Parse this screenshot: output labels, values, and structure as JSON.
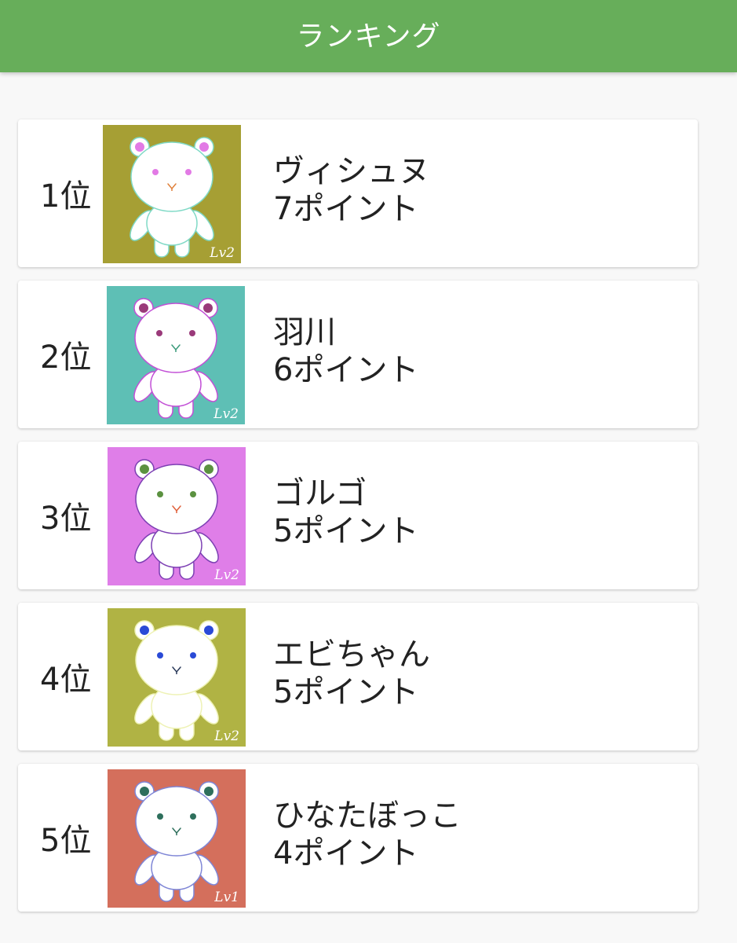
{
  "header": {
    "title": "ランキング"
  },
  "rankings": [
    {
      "rank": "1位",
      "name": "ヴィシュヌ",
      "points": "7ポイント",
      "level": "Lv2",
      "bg": "#a69f34",
      "outline": "#7fd9c6",
      "ear": "#e27ae5",
      "eye": "#e27ae5",
      "nose": "#e0803a"
    },
    {
      "rank": "2位",
      "name": "羽川",
      "points": "6ポイント",
      "level": "Lv2",
      "bg": "#5ebfb5",
      "outline": "#c24fd6",
      "ear": "#9a3a7a",
      "eye": "#9a3a7a",
      "nose": "#3a9a7a"
    },
    {
      "rank": "3位",
      "name": "ゴルゴ",
      "points": "5ポイント",
      "level": "Lv2",
      "bg": "#df7ee8",
      "outline": "#7c3fb3",
      "ear": "#5b9140",
      "eye": "#5b9140",
      "nose": "#e0603a"
    },
    {
      "rank": "4位",
      "name": "エビちゃん",
      "points": "5ポイント",
      "level": "Lv2",
      "bg": "#b0b344",
      "outline": "#eef2b5",
      "ear": "#2a4ad6",
      "eye": "#2a4ad6",
      "nose": "#2a3a5a"
    },
    {
      "rank": "5位",
      "name": "ひなたぼっこ",
      "points": "4ポイント",
      "level": "Lv1",
      "bg": "#d46f5c",
      "outline": "#7f86d6",
      "ear": "#2e6f5c",
      "eye": "#2e6f5c",
      "nose": "#2e6f5c"
    }
  ]
}
